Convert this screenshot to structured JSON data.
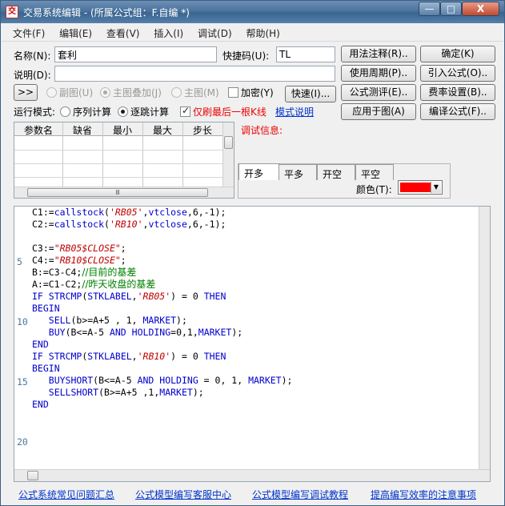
{
  "window": {
    "title": "交易系统编辑 - (所属公式组：F.自编 *)",
    "app_icon": "交",
    "min_label": "—",
    "max_label": "□",
    "close_label": "X"
  },
  "menu": [
    "文件(F)",
    "编辑(E)",
    "查看(V)",
    "插入(I)",
    "调试(D)",
    "帮助(H)"
  ],
  "form": {
    "name_label": "名称(N):",
    "name_value": "套利",
    "shortcut_label": "快捷码(U):",
    "shortcut_value": "TL",
    "desc_label": "说明(D):",
    "desc_value": "",
    "expand_label": ">>",
    "opt_sub": "副图(U)",
    "opt_main_overlay": "主图叠加(J)",
    "opt_main": "主图(M)",
    "opt_encrypt": "加密(Y)",
    "fast_button": "快速(I)..."
  },
  "right_buttons": [
    "用法注释(R)..",
    "确定(K)",
    "使用周期(P)..",
    "引入公式(O)..",
    "公式测评(E)..",
    "费率设置(B)..",
    "应用于图(A)",
    "编译公式(F).."
  ],
  "mode": {
    "label": "运行模式:",
    "seq": "序列计算",
    "tick": "逐跳计算",
    "last_only": "仅刷最后一根K线",
    "mode_help": "模式说明"
  },
  "param_grid": {
    "headers": [
      "参数名",
      "缺省",
      "最小",
      "最大",
      "步长"
    ],
    "scroll_thumb_label": "Ⅲ"
  },
  "debug_label": "调试信息:",
  "tabs": [
    "开多",
    "平多",
    "开空",
    "平空"
  ],
  "color_label": "颜色(T):",
  "color_value": "#ff0000",
  "line_numbers": [
    "5",
    "10",
    "15",
    "20"
  ],
  "code_lines": [
    "C1:=callstock('RB05',vtclose,6,-1);",
    "C2:=callstock('RB10',vtclose,6,-1);",
    "",
    "C3:=\"RB05$CLOSE\";",
    "C4:=\"RB10$CLOSE\";",
    "B:=C3-C4;//目前的基差",
    "A:=C1-C2;//昨天收盘的基差",
    "IF STRCMP(STKLABEL,'RB05') = 0 THEN",
    "BEGIN",
    "   SELL(b>=A+5 , 1, MARKET);",
    "   BUY(B<=A-5 AND HOLDING=0,1,MARKET);",
    "END",
    "IF STRCMP(STKLABEL,'RB10') = 0 THEN",
    "BEGIN",
    "   BUYSHORT(B<=A-5 AND HOLDING = 0, 1, MARKET);",
    "   SELLSHORT(B>=A+5 ,1,MARKET);",
    "END"
  ],
  "footer_links": [
    "公式系统常见问题汇总",
    "公式模型编写客服中心",
    "公式模型编写调试教程",
    "提高编写效率的注意事项"
  ]
}
